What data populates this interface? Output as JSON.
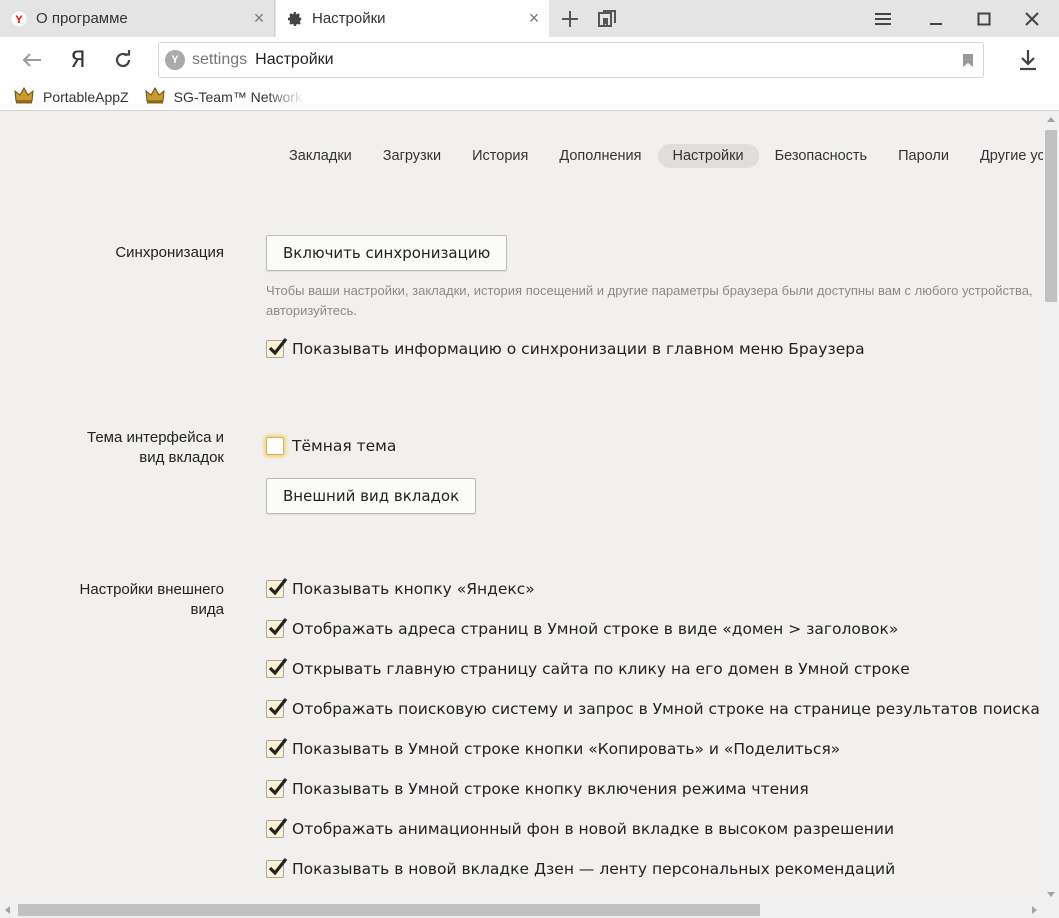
{
  "tabs": [
    {
      "title": "О программе",
      "icon": "yandex-icon",
      "close": "×"
    },
    {
      "title": "Настройки",
      "icon": "gear-icon",
      "close": "×"
    }
  ],
  "toolbar": {
    "ya_label": "Я",
    "url_domain": "settings",
    "url_title": "Настройки"
  },
  "bookmarks": [
    {
      "label": "PortableAppZ",
      "icon": "crown-icon"
    },
    {
      "label": "SG-Team™ Network",
      "icon": "crown-icon"
    }
  ],
  "section_nav": [
    {
      "label": "Закладки",
      "active": false
    },
    {
      "label": "Загрузки",
      "active": false
    },
    {
      "label": "История",
      "active": false
    },
    {
      "label": "Дополнения",
      "active": false
    },
    {
      "label": "Настройки",
      "active": true
    },
    {
      "label": "Безопасность",
      "active": false
    },
    {
      "label": "Пароли",
      "active": false
    },
    {
      "label": "Другие устройства",
      "active": false
    }
  ],
  "sync": {
    "label": "Синхронизация",
    "button": "Включить синхронизацию",
    "hint_line1": "Чтобы ваши настройки, закладки, история посещений и другие параметры браузера были доступны вам с любого устройства,",
    "hint_line2": "авторизуйтесь.",
    "checkbox": {
      "label": "Показывать информацию о синхронизации в главном меню Браузера",
      "checked": true
    }
  },
  "theme": {
    "label_line1": "Тема интерфейса и",
    "label_line2": "вид вкладок",
    "checkbox": {
      "label": "Тёмная тема",
      "checked": false
    },
    "button": "Внешний вид вкладок"
  },
  "appearance": {
    "label_line1": "Настройки внешнего",
    "label_line2": "вида",
    "options": [
      {
        "label": "Показывать кнопку «Яндекс»",
        "checked": true
      },
      {
        "label": "Отображать адреса страниц в Умной строке в виде «домен > заголовок»",
        "checked": true
      },
      {
        "label": "Открывать главную страницу сайта по клику на его домен в Умной строке",
        "checked": true
      },
      {
        "label": "Отображать поисковую систему и запрос в Умной строке на странице результатов поиска",
        "checked": true
      },
      {
        "label": "Показывать в Умной строке кнопки «Копировать» и «Поделиться»",
        "checked": true
      },
      {
        "label": "Показывать в Умной строке кнопку включения режима чтения",
        "checked": true
      },
      {
        "label": "Отображать анимационный фон в новой вкладке в высоком разрешении",
        "checked": true
      },
      {
        "label": "Показывать в новой вкладке Дзен — ленту персональных рекомендаций",
        "checked": true
      }
    ]
  },
  "colors": {
    "page_bg": "#f2f0ee",
    "checkbox_fill": "#fbf3d4",
    "focus_glow": "#f4d47a",
    "hint_text": "#8c8a87"
  }
}
